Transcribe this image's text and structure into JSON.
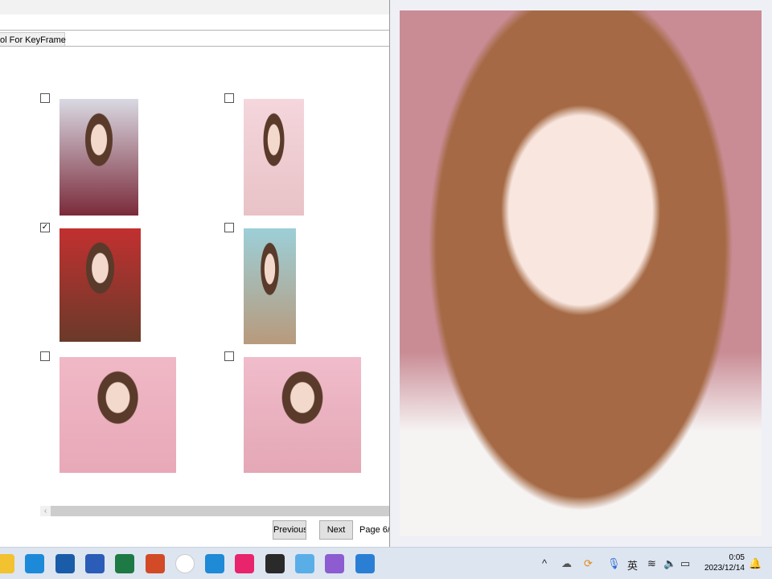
{
  "tab": {
    "label": "ol For KeyFrame"
  },
  "grid": {
    "items": [
      {
        "checked": false,
        "colors": [
          "#d9d9e3",
          "#7a2a3a"
        ]
      },
      {
        "checked": false,
        "colors": [
          "#f4d6dc",
          "#e8c2c6"
        ]
      },
      {
        "checked": true,
        "colors": [
          "#c23030",
          "#6a3a2a"
        ]
      },
      {
        "checked": false,
        "colors": [
          "#9ccfd8",
          "#b89a7c"
        ]
      },
      {
        "checked": false,
        "colors": [
          "#f0b8c6",
          "#e8a8b8"
        ]
      },
      {
        "checked": false,
        "colors": [
          "#f0bccb",
          "#e4a7b5"
        ]
      }
    ]
  },
  "pager": {
    "previous": "Previous",
    "next": "Next",
    "page": "Page 6/"
  },
  "preview": {
    "colors": [
      "#c98c95",
      "#a56a45",
      "#f6f3f3"
    ]
  },
  "taskbar": {
    "apps": [
      {
        "name": "file-explorer",
        "color": "#f2c230"
      },
      {
        "name": "edge",
        "color": "#1c8ad8"
      },
      {
        "name": "store",
        "color": "#1a5ca8"
      },
      {
        "name": "word",
        "color": "#2b5cb8"
      },
      {
        "name": "excel",
        "color": "#1e7a44"
      },
      {
        "name": "powerpoint",
        "color": "#d24a26"
      },
      {
        "name": "app-dots",
        "color": "#ffffff"
      },
      {
        "name": "vscode",
        "color": "#1f8ad6"
      },
      {
        "name": "pink-app",
        "color": "#e8246c"
      },
      {
        "name": "obs",
        "color": "#2a2a2a"
      },
      {
        "name": "notepad",
        "color": "#5aaee8"
      },
      {
        "name": "visual-studio",
        "color": "#8c5cd0"
      },
      {
        "name": "active-app",
        "color": "#2a7fd4"
      }
    ],
    "tray": {
      "ime": "英",
      "time": "0:05",
      "date": "2023/12/14"
    }
  }
}
